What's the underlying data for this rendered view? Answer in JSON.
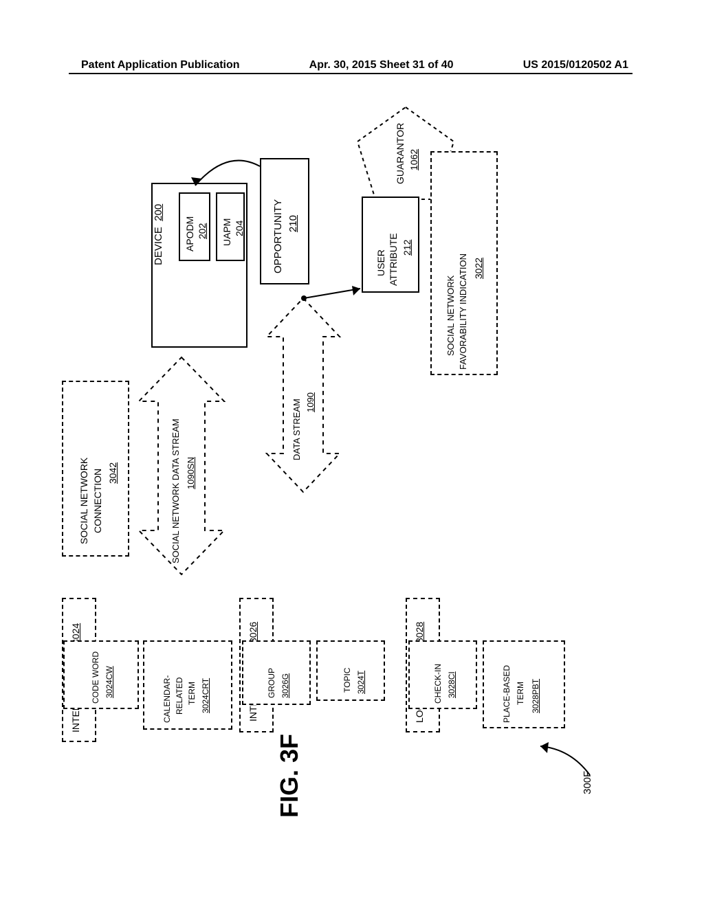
{
  "header": {
    "left": "Patent Application Publication",
    "mid": "Apr. 30, 2015  Sheet 31 of 40",
    "right": "US 2015/0120502 A1"
  },
  "fig": {
    "label": "FIG. 3F",
    "callout": "300F"
  },
  "device": {
    "label": "DEVICE",
    "ref": "200"
  },
  "apodm": {
    "label": "APODM",
    "ref": "202"
  },
  "uapm": {
    "label": "UAPM",
    "ref": "204"
  },
  "opportunity": {
    "label": "OPPORTUNITY",
    "ref": "210"
  },
  "guarantor": {
    "label": "GUARANTOR",
    "ref": "1062"
  },
  "user_attr": {
    "label": "USER\nATTRIBUTE",
    "ref": "212"
  },
  "snc": {
    "label": "SOCIAL NETWORK\nCONNECTION",
    "ref": "3042"
  },
  "snfi": {
    "label": "SOCIAL NETWORK\nFAVORABILITY INDICATION",
    "ref": "3022"
  },
  "snds": {
    "label": "SOCIAL NETWORK DATA STREAM",
    "ref": "1090SN"
  },
  "ds": {
    "label": "DATA STREAM",
    "ref": "1090"
  },
  "intention": {
    "label": "INTENTION",
    "ref": "3024"
  },
  "interest": {
    "label": "INTEREST",
    "ref": "3026"
  },
  "location": {
    "label": "LOCATION",
    "ref": "3028"
  },
  "codeword": {
    "label": "CODE WORD",
    "ref": "3024CW"
  },
  "crt": {
    "label": "CALENDAR-\nRELATED\nTERM",
    "ref": "3024CRT"
  },
  "group": {
    "label": "GROUP",
    "ref": "3026G"
  },
  "topic": {
    "label": "TOPIC",
    "ref": "3024T"
  },
  "checkin": {
    "label": "CHECK-IN",
    "ref": "3028CI"
  },
  "pbt": {
    "label": "PLACE-BASED\nTERM",
    "ref": "3028PBT"
  }
}
